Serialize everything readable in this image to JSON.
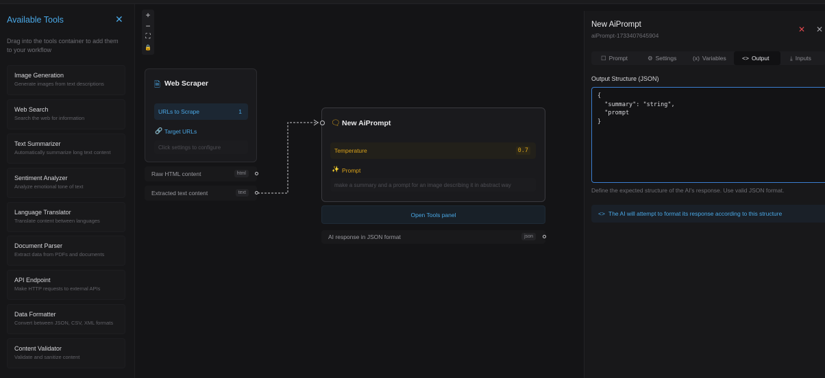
{
  "sidebar": {
    "title": "Available Tools",
    "description": "Drag into the tools container to add them to your workflow",
    "tools": [
      {
        "name": "Image Generation",
        "description": "Generate images from text descriptions"
      },
      {
        "name": "Web Search",
        "description": "Search the web for information"
      },
      {
        "name": "Text Summarizer",
        "description": "Automatically summarize long text content"
      },
      {
        "name": "Sentiment Analyzer",
        "description": "Analyze emotional tone of text"
      },
      {
        "name": "Language Translator",
        "description": "Translate content between languages"
      },
      {
        "name": "Document Parser",
        "description": "Extract data from PDFs and documents"
      },
      {
        "name": "API Endpoint",
        "description": "Make HTTP requests to external APIs"
      },
      {
        "name": "Data Formatter",
        "description": "Convert between JSON, CSV, XML formats"
      },
      {
        "name": "Content Validator",
        "description": "Validate and sanitize content"
      }
    ]
  },
  "zoom_controls": [
    "+",
    "−",
    "⛶",
    "🔒"
  ],
  "web_scraper": {
    "title": "Web Scraper",
    "urls_label": "URLs to Scrape",
    "urls_count": "1",
    "target_label": "Target URLs",
    "hint": "Click settings to configure",
    "outputs": [
      {
        "label": "Raw HTML content",
        "badge": "html"
      },
      {
        "label": "Extracted text content",
        "badge": "text"
      }
    ]
  },
  "ai_node": {
    "title": "New AiPrompt",
    "temperature_label": "Temperature",
    "temperature_value": "0.7",
    "prompt_label": "Prompt",
    "prompt_text": "make a summary and a prompt for an image describing it in abstract way",
    "open_tools": "Open Tools panel",
    "output_label": "AI response in JSON format",
    "output_badge": "json"
  },
  "panel": {
    "title": "New AiPrompt",
    "subtitle": "aiPrompt-1733407645904",
    "tabs": [
      {
        "label": "Prompt",
        "icon": "☐"
      },
      {
        "label": "Settings",
        "icon": "⚙"
      },
      {
        "label": "Variables",
        "icon": "(x)"
      },
      {
        "label": "Output",
        "icon": "<>"
      },
      {
        "label": "Inputs",
        "icon": "⤓"
      }
    ],
    "section_label": "Output Structure (JSON)",
    "json_text": "{\n  \"summary\": \"string\",\n  \"prompt\n}",
    "help": "Define the expected structure of the AI's response. Use valid JSON format.",
    "note": "The AI will attempt to format its response according to this structure"
  },
  "colors": {
    "accent_blue": "#4aa8e6",
    "accent_amber": "#d9a21b",
    "close_red": "#e0484e"
  }
}
